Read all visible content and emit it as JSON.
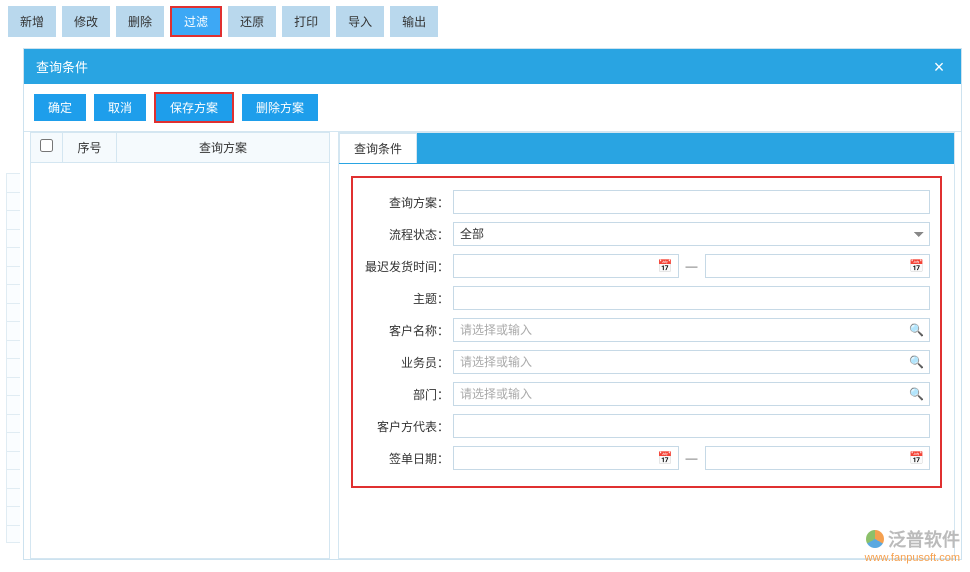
{
  "toolbar": {
    "new": "新增",
    "edit": "修改",
    "delete": "删除",
    "filter": "过滤",
    "restore": "还原",
    "print": "打印",
    "import": "导入",
    "export": "输出"
  },
  "dialog": {
    "title": "查询条件",
    "close": "×",
    "buttons": {
      "ok": "确定",
      "cancel": "取消",
      "savePlan": "保存方案",
      "deletePlan": "删除方案"
    },
    "grid": {
      "col_checkbox": "",
      "col_seq": "序号",
      "col_plan": "查询方案"
    },
    "tab": "查询条件",
    "form": {
      "queryPlan": {
        "label": "查询方案：",
        "value": ""
      },
      "flowStatus": {
        "label": "流程状态：",
        "value": "全部"
      },
      "latestShip": {
        "label": "最迟发货时间：",
        "from": "",
        "to": ""
      },
      "subject": {
        "label": "主题：",
        "value": ""
      },
      "customer": {
        "label": "客户名称：",
        "placeholder": "请选择或输入",
        "value": ""
      },
      "salesman": {
        "label": "业务员：",
        "placeholder": "请选择或输入",
        "value": ""
      },
      "department": {
        "label": "部门：",
        "placeholder": "请选择或输入",
        "value": ""
      },
      "custRep": {
        "label": "客户方代表：",
        "value": ""
      },
      "signDate": {
        "label": "签单日期：",
        "from": "",
        "to": ""
      }
    },
    "icons": {
      "calendar": "📅",
      "search": "🔍",
      "dash": "—"
    }
  },
  "watermark": {
    "name": "泛普软件",
    "url": "www.fanpusoft.com"
  }
}
